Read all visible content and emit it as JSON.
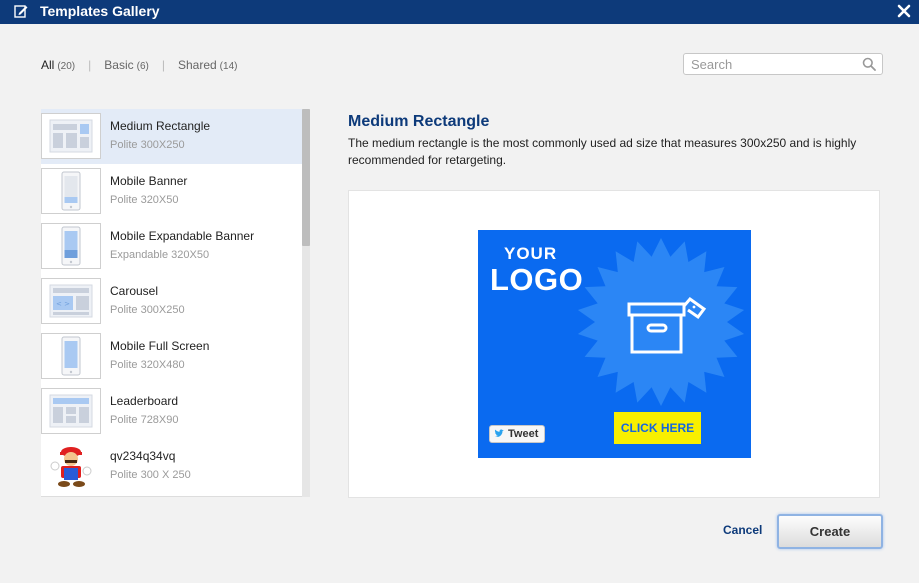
{
  "window": {
    "title": "Templates Gallery",
    "title_icon": "edit-icon",
    "close_icon": "close-icon",
    "titlebar_color": "#0d3a7a"
  },
  "filters": [
    {
      "label": "All",
      "count": "(20)",
      "active": true
    },
    {
      "label": "Basic",
      "count": "(6)",
      "active": false
    },
    {
      "label": "Shared",
      "count": "(14)",
      "active": false
    }
  ],
  "search": {
    "placeholder": "Search",
    "value": "",
    "icon": "search-icon"
  },
  "templates": [
    {
      "name": "Medium Rectangle",
      "size": "Polite 300X250",
      "selected": true,
      "thumb": "layout-rectangle"
    },
    {
      "name": "Mobile Banner",
      "size": "Polite 320X50",
      "selected": false,
      "thumb": "phone-banner"
    },
    {
      "name": "Mobile Expandable Banner",
      "size": "Expandable 320X50",
      "selected": false,
      "thumb": "phone-expandable"
    },
    {
      "name": "Carousel",
      "size": "Polite 300X250",
      "selected": false,
      "thumb": "carousel"
    },
    {
      "name": "Mobile Full Screen",
      "size": "Polite 320X480",
      "selected": false,
      "thumb": "phone-fullscreen"
    },
    {
      "name": "Leaderboard",
      "size": "Polite 728X90",
      "selected": false,
      "thumb": "leaderboard"
    },
    {
      "name": "qv234q34vq",
      "size": "Polite 300 X 250",
      "selected": false,
      "thumb": "character-image"
    }
  ],
  "preview": {
    "title": "Medium Rectangle",
    "description": "The medium rectangle is the most commonly used ad size that measures 300x250 and is highly recommended for retargeting.",
    "ad": {
      "your_text": "YOUR",
      "logo_text": "LOGO",
      "tweet_label": "Tweet",
      "cta_label": "CLICK HERE",
      "background_color": "#0a6af0",
      "cta_color": "#f8ef00",
      "center_icon": "box-with-tag-icon"
    }
  },
  "actions": {
    "cancel_label": "Cancel",
    "create_label": "Create"
  }
}
